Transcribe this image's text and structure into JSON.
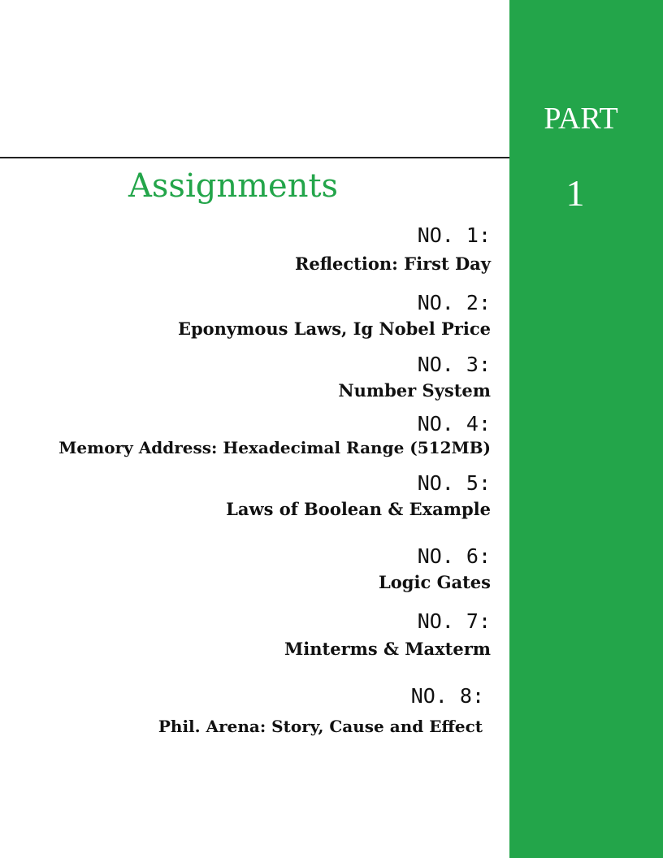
{
  "side": {
    "part_word": "PART",
    "part_number": "1"
  },
  "heading": "Assignments",
  "assignments": [
    {
      "label": "NO. 1:",
      "title": "Reflection: First Day"
    },
    {
      "label": "NO. 2:",
      "title": "Eponymous Laws, Ig Nobel Price"
    },
    {
      "label": "NO. 3:",
      "title": "Number System"
    },
    {
      "label": "NO. 4:",
      "title": "Memory Address: Hexadecimal Range (512MB)"
    },
    {
      "label": "NO. 5:",
      "title": "Laws of Boolean & Example"
    },
    {
      "label": "NO. 6:",
      "title": "Logic Gates"
    },
    {
      "label": "NO. 7:",
      "title": "Minterms & Maxterm"
    },
    {
      "label": "NO. 8:",
      "title": "Phil. Arena: Story, Cause and Effect"
    }
  ],
  "colors": {
    "accent_green": "#23a54a",
    "text": "#111111"
  }
}
